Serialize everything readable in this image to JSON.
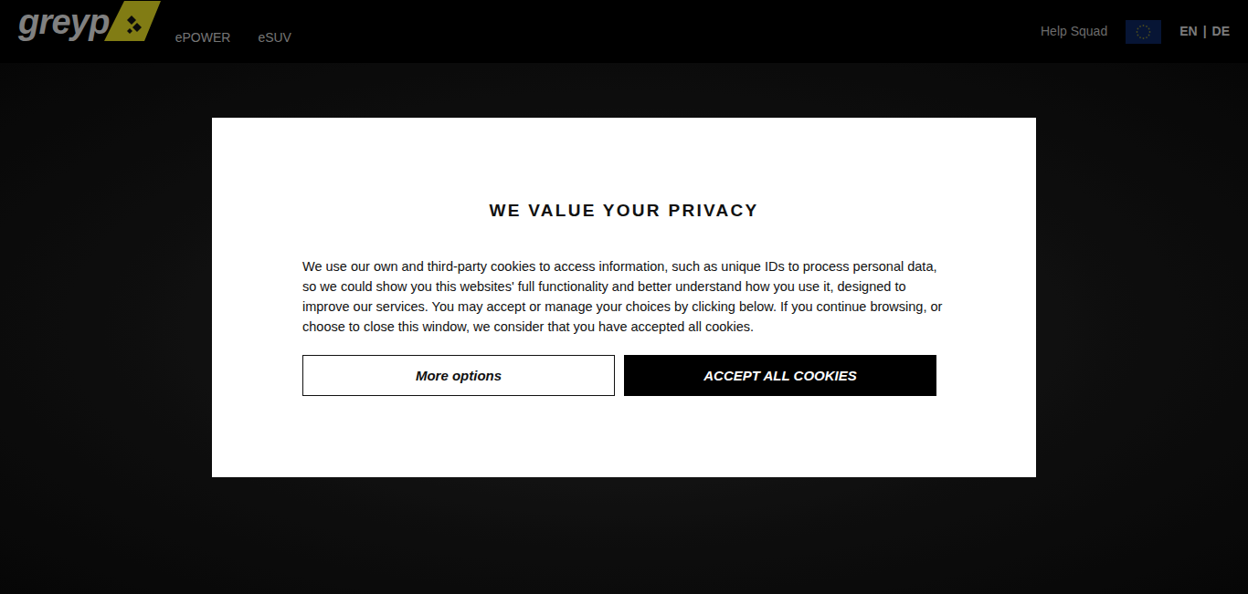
{
  "header": {
    "logo": {
      "text": "greyp"
    },
    "nav": [
      {
        "label": "ePOWER",
        "selected": false
      },
      {
        "label": "eSUV",
        "selected": false
      }
    ],
    "help": "Help Squad",
    "languages": [
      {
        "label": "EN"
      },
      {
        "label": "DE"
      }
    ],
    "separator": "|"
  },
  "modal": {
    "title": "WE VALUE YOUR PRIVACY",
    "body": "We use our own and third-party cookies to access information, such as unique IDs to process personal data, so we could show you this websites' full functionality and better understand how you use it, designed to improve our services. You may accept or manage your choices by clicking below. If you continue browsing, or choose to close this window, we consider that you have accepted all cookies.",
    "buttons": [
      {
        "label": "More options",
        "kind": "outline"
      },
      {
        "label": "ACCEPT ALL COOKIES",
        "kind": "primary"
      }
    ]
  }
}
